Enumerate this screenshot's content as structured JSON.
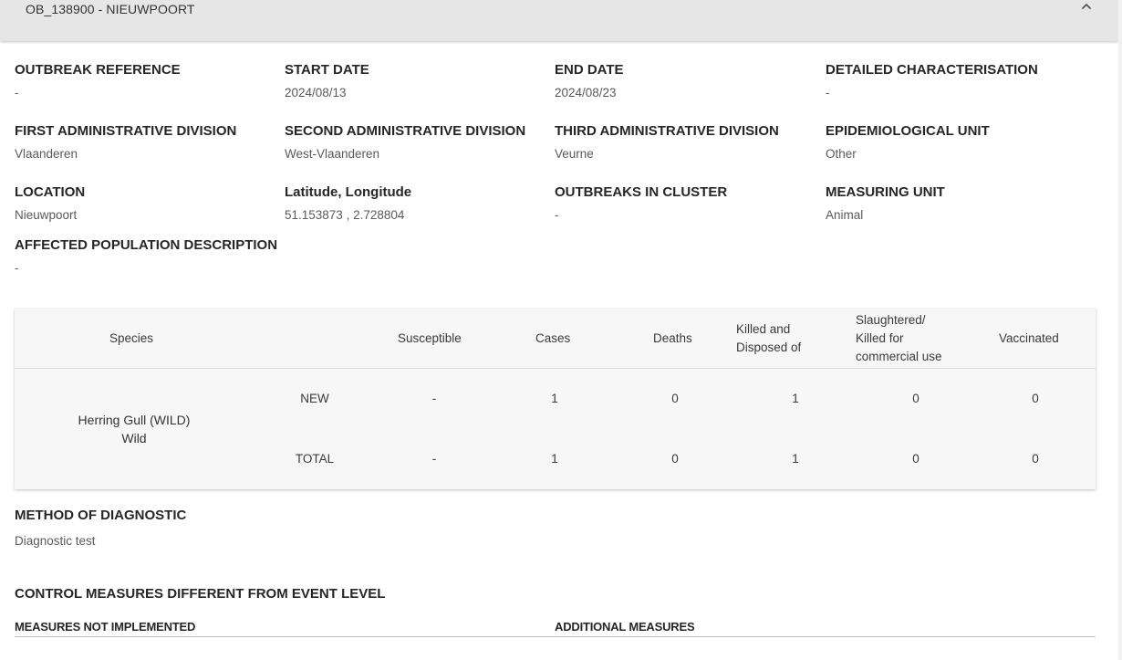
{
  "header": {
    "title": "OB_138900 - NIEUWPOORT",
    "collapse_icon": "chevron-up-icon"
  },
  "fields": [
    {
      "label": "OUTBREAK REFERENCE",
      "value": "-"
    },
    {
      "label": "START DATE",
      "value": "2024/08/13"
    },
    {
      "label": "END DATE",
      "value": "2024/08/23"
    },
    {
      "label": "DETAILED CHARACTERISATION",
      "value": "-"
    },
    {
      "label": "FIRST ADMINISTRATIVE DIVISION",
      "value": "Vlaanderen"
    },
    {
      "label": "SECOND ADMINISTRATIVE DIVISION",
      "value": "West-Vlaanderen"
    },
    {
      "label": "THIRD ADMINISTRATIVE DIVISION",
      "value": "Veurne"
    },
    {
      "label": "EPIDEMIOLOGICAL UNIT",
      "value": "Other"
    },
    {
      "label": "LOCATION",
      "value": "Nieuwpoort"
    },
    {
      "label": "Latitude, Longitude",
      "value": "51.153873 , 2.728804"
    },
    {
      "label": "OUTBREAKS IN CLUSTER",
      "value": "-"
    },
    {
      "label": "MEASURING UNIT",
      "value": "Animal"
    },
    {
      "label": "AFFECTED POPULATION DESCRIPTION",
      "value": "-"
    }
  ],
  "table": {
    "headers": {
      "species": "Species",
      "susceptible": "Susceptible",
      "cases": "Cases",
      "deaths": "Deaths",
      "killed_1": "Killed and",
      "killed_2": "Disposed of",
      "slaughtered_1": "Slaughtered/",
      "slaughtered_2": "Killed for",
      "slaughtered_3": "commercial use",
      "vaccinated": "Vaccinated"
    },
    "species_name": "Herring Gull (WILD)",
    "species_type": "Wild",
    "rows": [
      {
        "label": "NEW",
        "susceptible": "-",
        "cases": "1",
        "deaths": "0",
        "killed": "1",
        "slaughtered": "0",
        "vaccinated": "0"
      },
      {
        "label": "TOTAL",
        "susceptible": "-",
        "cases": "1",
        "deaths": "0",
        "killed": "1",
        "slaughtered": "0",
        "vaccinated": "0"
      }
    ]
  },
  "diagnostic": {
    "label": "METHOD OF DIAGNOSTIC",
    "value": "Diagnostic test"
  },
  "control": {
    "title": "CONTROL MEASURES DIFFERENT FROM EVENT LEVEL",
    "not_implemented": "MEASURES NOT IMPLEMENTED",
    "additional": "ADDITIONAL MEASURES"
  }
}
